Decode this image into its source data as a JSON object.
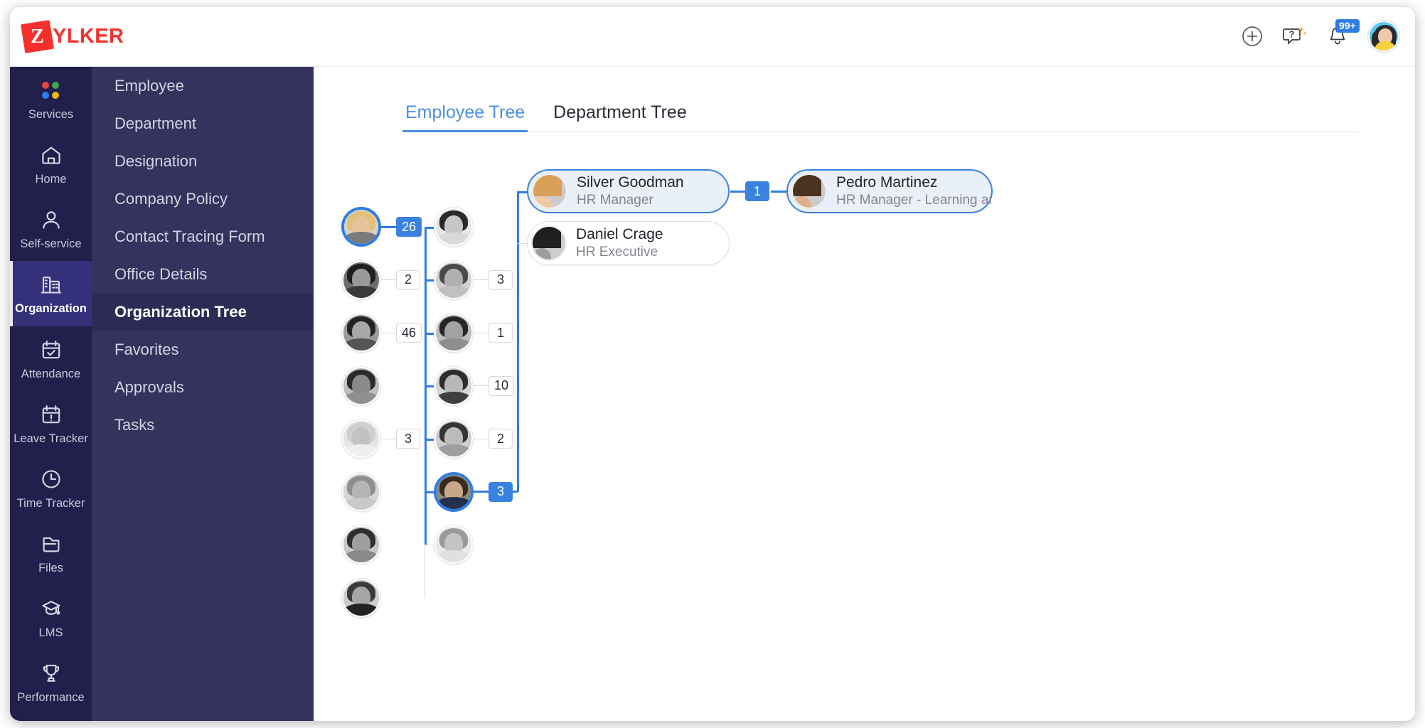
{
  "app": {
    "logo_initial": "Z",
    "logo_text": "YLKER"
  },
  "topbar": {
    "add_icon": "plus-circle-icon",
    "help_icon": "help-chat-icon",
    "notifications_icon": "bell-icon",
    "notifications_count": "99+",
    "avatar": "user-avatar"
  },
  "rail": {
    "items": [
      {
        "label": "Services",
        "icon": "services-dots-icon",
        "active": false
      },
      {
        "label": "Home",
        "icon": "home-icon",
        "active": false
      },
      {
        "label": "Self-service",
        "icon": "person-icon",
        "active": false
      },
      {
        "label": "Organization",
        "icon": "building-icon",
        "active": true
      },
      {
        "label": "Attendance",
        "icon": "calendar-check-icon",
        "active": false
      },
      {
        "label": "Leave Tracker",
        "icon": "calendar-alert-icon",
        "active": false
      },
      {
        "label": "Time Tracker",
        "icon": "clock-icon",
        "active": false
      },
      {
        "label": "Files",
        "icon": "folder-icon",
        "active": false
      },
      {
        "label": "LMS",
        "icon": "graduation-cap-icon",
        "active": false
      },
      {
        "label": "Performance",
        "icon": "trophy-icon",
        "active": false
      }
    ],
    "dot_colors": [
      "#e8453c",
      "#3aa757",
      "#2d7ff9",
      "#f2b705"
    ]
  },
  "subnav": {
    "items": [
      {
        "label": "Employee",
        "active": false
      },
      {
        "label": "Department",
        "active": false
      },
      {
        "label": "Designation",
        "active": false
      },
      {
        "label": "Company Policy",
        "active": false
      },
      {
        "label": "Contact Tracing Form",
        "active": false
      },
      {
        "label": "Office Details",
        "active": false
      },
      {
        "label": "Organization Tree",
        "active": true
      },
      {
        "label": "Favorites",
        "active": false
      },
      {
        "label": "Approvals",
        "active": false
      },
      {
        "label": "Tasks",
        "active": false
      }
    ]
  },
  "tabs": [
    {
      "label": "Employee Tree",
      "active": true
    },
    {
      "label": "Department Tree",
      "active": false
    }
  ],
  "colors": {
    "accent": "#2e7de1",
    "card_selected_bg": "#e9f0fa",
    "rail_bg": "#211f4b",
    "subnav_bg": "#33335e",
    "brand_red": "#f5302c"
  },
  "tree": {
    "column1": [
      {
        "badge": "26",
        "selected": true,
        "skin": "#e8c39a",
        "hair": "#e2c07a",
        "shirt": "#7a7a7a",
        "bg": "#d8d2cb"
      },
      {
        "badge": "2",
        "selected": false,
        "skin": "#9a9a9a",
        "hair": "#1e1e1e",
        "shirt": "#3a3a3a",
        "bg": "#6e6e6e"
      },
      {
        "badge": "46",
        "selected": false,
        "skin": "#a8a8a8",
        "hair": "#242424",
        "shirt": "#555555",
        "bg": "#9a9a9a"
      },
      {
        "badge": "",
        "selected": false,
        "skin": "#8a8a8a",
        "hair": "#2b2b2b",
        "shirt": "#8f8f8f",
        "bg": "#bdbdbd"
      },
      {
        "badge": "3",
        "selected": false,
        "skin": "#c2c2c2",
        "hair": "#cfcfcf",
        "shirt": "#efefef",
        "bg": "#e4e4e4"
      },
      {
        "badge": "",
        "selected": false,
        "skin": "#b5b5b5",
        "hair": "#8f8f8f",
        "shirt": "#c9c9c9",
        "bg": "#d6d6d6"
      },
      {
        "badge": "",
        "selected": false,
        "skin": "#9f9f9f",
        "hair": "#2f2f2f",
        "shirt": "#8a8a8a",
        "bg": "#c7c7c7"
      },
      {
        "badge": "",
        "selected": false,
        "skin": "#a6a6a6",
        "hair": "#3a3a3a",
        "shirt": "#222222",
        "bg": "#cccccc"
      }
    ],
    "column2": [
      {
        "badge": "",
        "selected": false,
        "skin": "#c6c6c6",
        "hair": "#2a2a2a",
        "shirt": "#d9d9d9",
        "bg": "#e6e6e6"
      },
      {
        "badge": "3",
        "selected": false,
        "skin": "#b0b0b0",
        "hair": "#4a4a4a",
        "shirt": "#c0c0c0",
        "bg": "#d2d2d2"
      },
      {
        "badge": "1",
        "selected": false,
        "skin": "#a2a2a2",
        "hair": "#262626",
        "shirt": "#8e8e8e",
        "bg": "#bdbdbd"
      },
      {
        "badge": "10",
        "selected": false,
        "skin": "#b8b8b8",
        "hair": "#2d2d2d",
        "shirt": "#3f3f3f",
        "bg": "#d5d5d5"
      },
      {
        "badge": "2",
        "selected": false,
        "skin": "#bcbcbc",
        "hair": "#353535",
        "shirt": "#9e9e9e",
        "bg": "#cfcfcf"
      },
      {
        "badge": "3",
        "selected": true,
        "skin": "#c9a887",
        "hair": "#3a2a1e",
        "shirt": "#23314f",
        "bg": "#8d8878"
      },
      {
        "badge": "",
        "selected": false,
        "skin": "#c4c4c4",
        "hair": "#9a9a9a",
        "shirt": "#e0e0e0",
        "bg": "#eaeaea"
      }
    ],
    "cards": [
      {
        "name": "Silver Goodman",
        "role": "HR Manager",
        "selected": true,
        "badge": "1",
        "photo": {
          "skin": "#f2c9a0",
          "hair": "#d9a05a",
          "shirt": "#f2f2f2",
          "bg": "#dcd6ce"
        }
      },
      {
        "name": "Daniel Crage",
        "role": "HR Executive",
        "selected": false,
        "badge": "",
        "photo": {
          "skin": "#9e9e9e",
          "hair": "#1f1f1f",
          "shirt": "#767676",
          "bg": "#c7c7c7"
        }
      },
      {
        "name": "Pedro Martinez",
        "role": "HR Manager - Learning and D…",
        "selected": true,
        "badge": "",
        "photo": {
          "skin": "#dcb18c",
          "hair": "#4a3321",
          "shirt": "#2f3c52",
          "bg": "#b9b4ab"
        }
      }
    ]
  }
}
